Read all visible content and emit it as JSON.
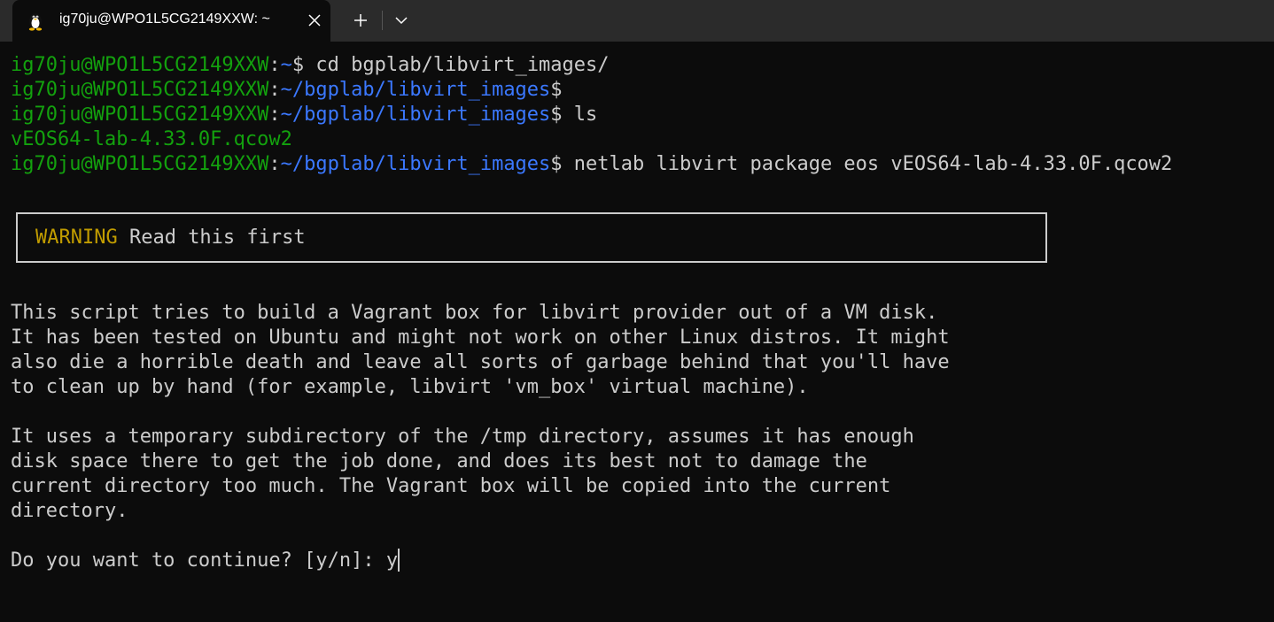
{
  "window": {
    "tab_title": "ig70ju@WPO1L5CG2149XXW: ~",
    "tab_icon": "linux-penguin-icon",
    "close_icon": "close-icon",
    "new_tab_icon": "plus-icon",
    "dropdown_icon": "chevron-down-icon"
  },
  "terminal": {
    "prompt_user": "ig70ju@WPO1L5CG2149XXW",
    "colors": {
      "background": "#0c0c0c",
      "user": "#13a10e",
      "path": "#3b78ff",
      "text": "#cccccc",
      "warning": "#c19c00"
    },
    "lines": [
      {
        "user": "ig70ju@WPO1L5CG2149XXW",
        "sep": ":",
        "path": "~",
        "dollar": "$",
        "cmd": " cd bgplab/libvirt_images/"
      },
      {
        "user": "ig70ju@WPO1L5CG2149XXW",
        "sep": ":",
        "path": "~/bgplab/libvirt_images",
        "dollar": "$",
        "cmd": ""
      },
      {
        "user": "ig70ju@WPO1L5CG2149XXW",
        "sep": ":",
        "path": "~/bgplab/libvirt_images",
        "dollar": "$",
        "cmd": " ls"
      },
      {
        "output": "vEOS64-lab-4.33.0F.qcow2"
      },
      {
        "user": "ig70ju@WPO1L5CG2149XXW",
        "sep": ":",
        "path": "~/bgplab/libvirt_images",
        "dollar": "$",
        "cmd": " netlab libvirt package eos vEOS64-lab-4.33.0F.qcow2"
      }
    ],
    "warning": {
      "label": "WARNING",
      "text": " Read this first"
    },
    "paragraph1": [
      "This script tries to build a Vagrant box for libvirt provider out of a VM disk.",
      "It has been tested on Ubuntu and might not work on other Linux distros. It might",
      "also die a horrible death and leave all sorts of garbage behind that you'll have",
      "to clean up by hand (for example, libvirt 'vm_box' virtual machine)."
    ],
    "paragraph2": [
      "It uses a temporary subdirectory of the /tmp directory, assumes it has enough",
      "disk space there to get the job done, and does its best not to damage the",
      "current directory too much. The Vagrant box will be copied into the current",
      "directory."
    ],
    "question": "Do you want to continue? [y/n]: ",
    "answer": "y"
  }
}
